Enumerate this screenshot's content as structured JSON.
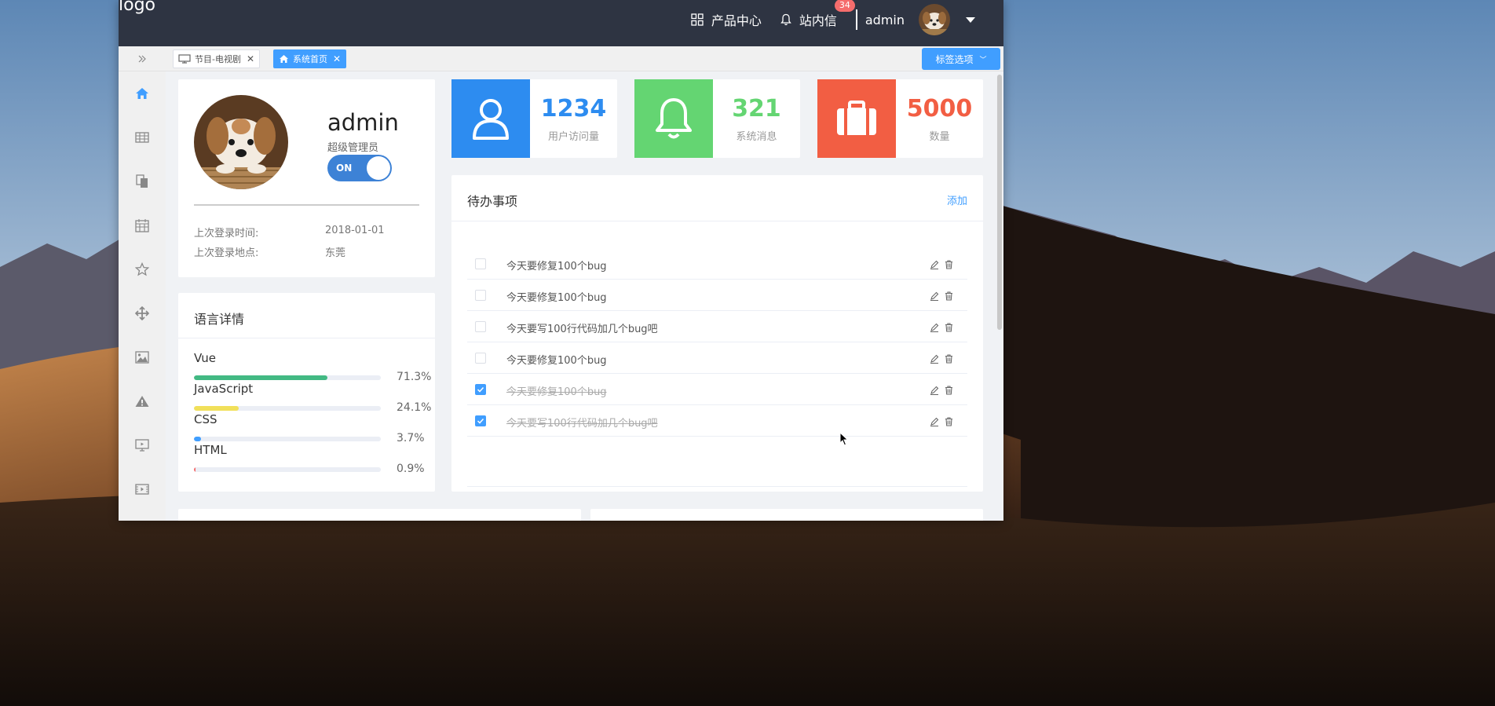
{
  "app": {
    "logo": "logo",
    "nav": {
      "products": "产品中心",
      "messages": "站内信",
      "message_count": "34",
      "user": "admin"
    }
  },
  "tags": [
    {
      "label": "节目-电视剧",
      "active": false
    },
    {
      "label": "系统首页",
      "active": true
    }
  ],
  "tag_options": "标签选项",
  "sidebar_icons": [
    "home-icon",
    "table-icon",
    "copy-icon",
    "calendar-icon",
    "star-icon",
    "move-icon",
    "image-icon",
    "warning-icon",
    "monitor-icon",
    "video-icon"
  ],
  "user_card": {
    "name": "admin",
    "role": "超级管理员",
    "toggle": "ON",
    "last_login_time_label": "上次登录时间:",
    "last_login_time": "2018-01-01",
    "last_login_place_label": "上次登录地点:",
    "last_login_place": "东莞"
  },
  "languages": {
    "title": "语言详情",
    "items": [
      {
        "name": "Vue",
        "percent": 71.3,
        "label": "71.3%",
        "color": "#42b983"
      },
      {
        "name": "JavaScript",
        "percent": 24.1,
        "label": "24.1%",
        "color": "#f1e05a"
      },
      {
        "name": "CSS",
        "percent": 3.7,
        "label": "3.7%",
        "color": "#409eff"
      },
      {
        "name": "HTML",
        "percent": 0.9,
        "label": "0.9%",
        "color": "#f56c6c"
      }
    ]
  },
  "stats": [
    {
      "value": "1234",
      "label": "用户访问量",
      "color": "#2d8cf0",
      "icon": "user-icon"
    },
    {
      "value": "321",
      "label": "系统消息",
      "color": "#64d572",
      "icon": "bell-icon"
    },
    {
      "value": "5000",
      "label": "数量",
      "color": "#f25e43",
      "icon": "briefcase-icon"
    }
  ],
  "todo": {
    "title": "待办事项",
    "add": "添加",
    "items": [
      {
        "text": "今天要修复100个bug",
        "done": false
      },
      {
        "text": "今天要修复100个bug",
        "done": false
      },
      {
        "text": "今天要写100行代码加几个bug吧",
        "done": false
      },
      {
        "text": "今天要修复100个bug",
        "done": false
      },
      {
        "text": "今天要修复100个bug",
        "done": true
      },
      {
        "text": "今天要写100行代码加几个bug吧",
        "done": true
      }
    ]
  },
  "colors": {
    "topbar": "#2e3442",
    "accent": "#409eff"
  }
}
